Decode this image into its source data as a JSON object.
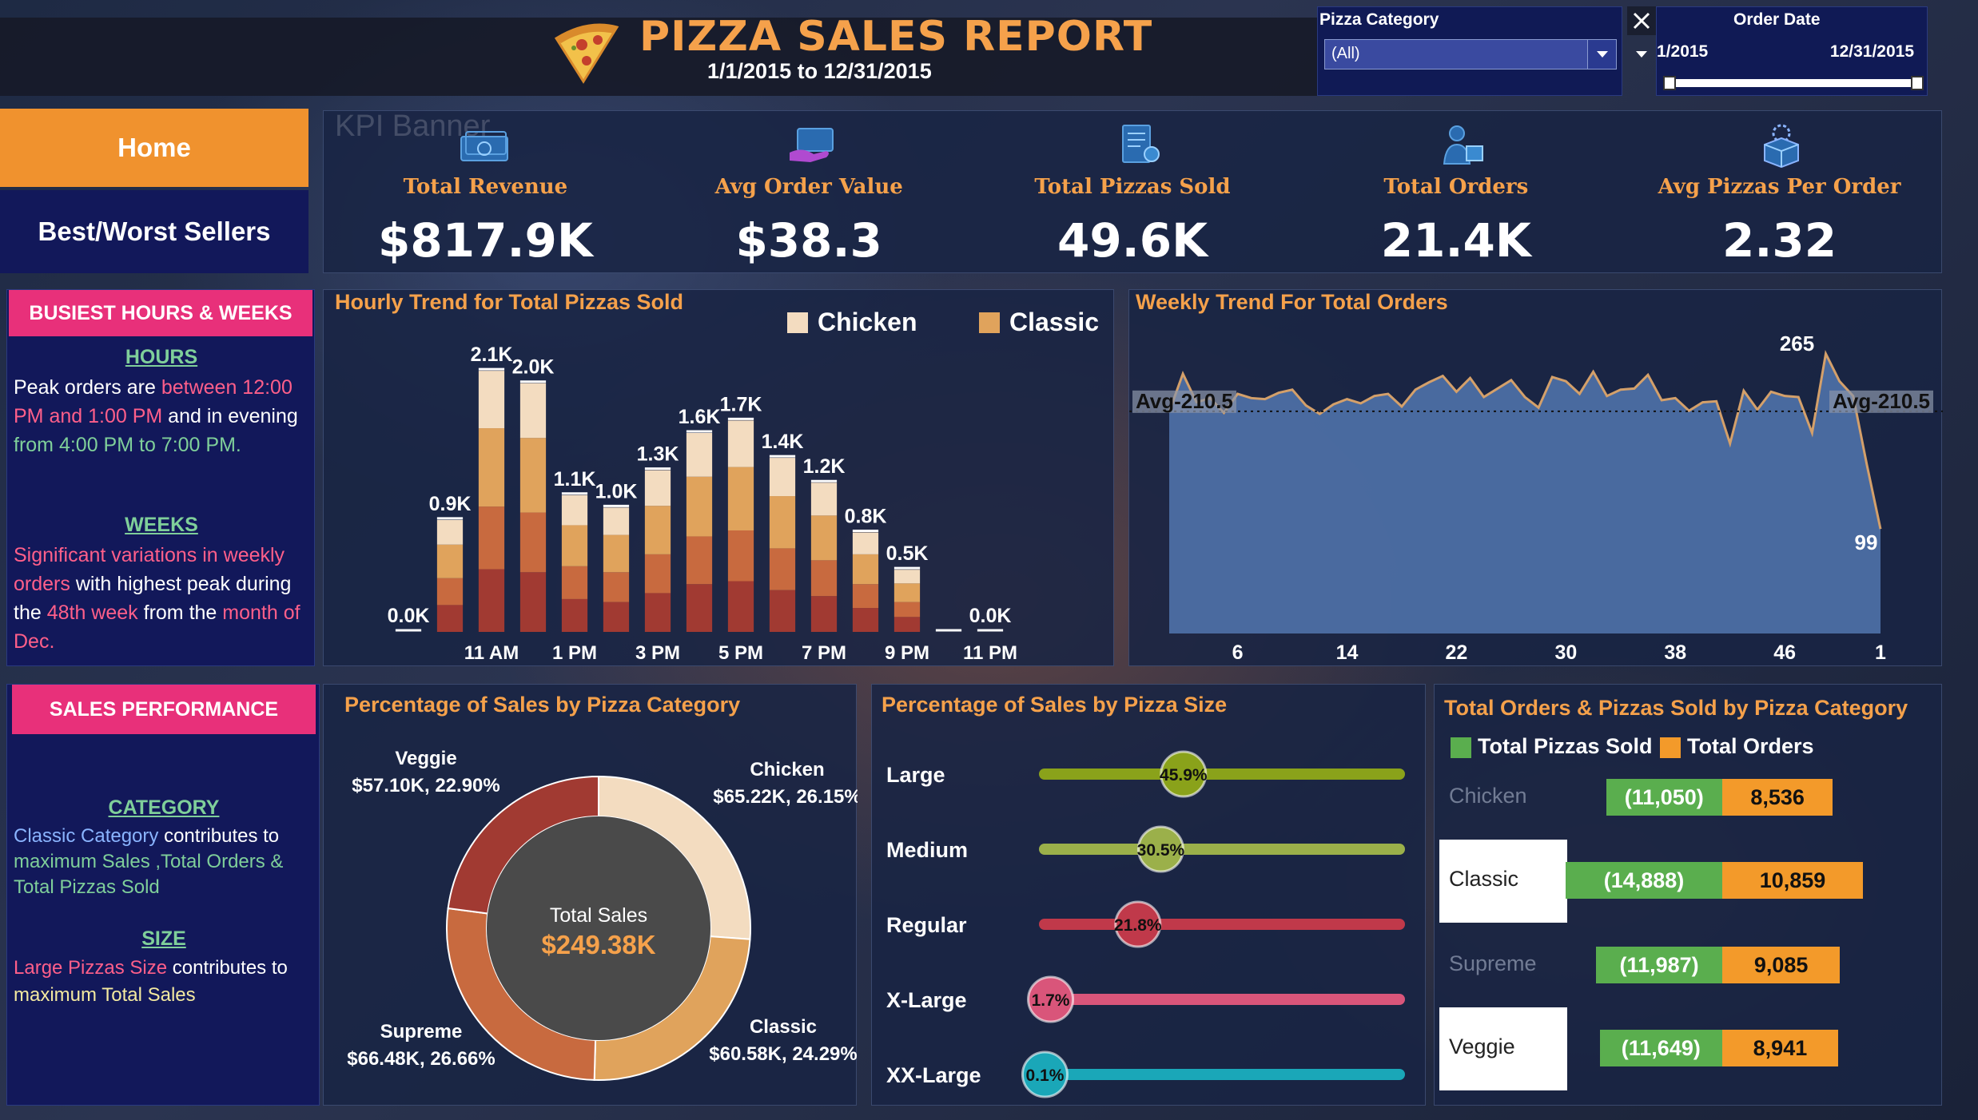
{
  "header": {
    "title": "PIZZA SALES REPORT",
    "date_range": "1/1/2015  to 12/31/2015",
    "logo_icon": "pizza-slice-icon"
  },
  "filters": {
    "category": {
      "label": "Pizza Category",
      "value": "(All)"
    },
    "order_date": {
      "label": "Order Date",
      "start": "1/2015",
      "end": "12/31/2015"
    }
  },
  "nav": {
    "home": "Home",
    "best_worst": "Best/Worst Sellers"
  },
  "kpi": {
    "banner_label": "KPI Banner",
    "items": [
      {
        "label": "Total Revenue",
        "value": "$817.9K",
        "icon": "cash-icon"
      },
      {
        "label": "Avg Order Value",
        "value": "$38.3",
        "icon": "card-payment-icon"
      },
      {
        "label": "Total Pizzas Sold",
        "value": "49.6K",
        "icon": "receipt-icon"
      },
      {
        "label": "Total Orders",
        "value": "21.4K",
        "icon": "delivery-person-icon"
      },
      {
        "label": "Avg Pizzas Per Order",
        "value": "2.32",
        "icon": "box-icon"
      }
    ]
  },
  "busiest": {
    "tab": "BUSIEST HOURS & WEEKS",
    "hours_heading": "HOURS",
    "hours_text": {
      "p1": "Peak orders are ",
      "p2": "between 12:00 PM and 1:00 PM",
      "p3": " and in evening ",
      "p4": "from 4:00 PM to 7:00 PM."
    },
    "weeks_heading": "WEEKS",
    "weeks_text": {
      "p1": "Significant variations in weekly orders",
      "p2": " with highest peak during the ",
      "p3": "48th week",
      "p4": " from the ",
      "p5": "month of Dec."
    }
  },
  "sales_perf": {
    "tab": "SALES PERFORMANCE",
    "category_heading": "CATEGORY",
    "category_text": {
      "p1": "Classic Category",
      "p2": " contributes to ",
      "p3": "maximum Sales ,Total Orders & Total Pizzas Sold"
    },
    "size_heading": "SIZE",
    "size_text": {
      "p1": "Large Pizzas Size",
      "p2": " contributes to ",
      "p3": "maximum Total Sales"
    }
  },
  "panels": {
    "hourly_title": "Hourly Trend for Total Pizzas Sold",
    "weekly_title": "Weekly Trend For Total Orders",
    "category_title": "Percentage of Sales by Pizza Category",
    "size_title": "Percentage of Sales by Pizza Size",
    "orders_title": "Total Orders & Pizzas Sold by Pizza Category"
  },
  "colors": {
    "accent_orange": "#f5a14b",
    "pink": "#e8307a",
    "navy": "#12185a",
    "chicken": "#f3dcc0",
    "classic": "#e0a35c",
    "supreme": "#c86a3f",
    "veggie": "#a13a32",
    "green_bar": "#5aae4e",
    "orange_bar": "#f39a2a"
  },
  "chart_data": [
    {
      "type": "bar",
      "title": "Hourly Trend for Total Pizzas Sold",
      "stacked": true,
      "legend": [
        "Chicken",
        "Classic"
      ],
      "legend_position": "top-right",
      "categories": [
        9,
        10,
        11,
        12,
        13,
        14,
        15,
        16,
        17,
        18,
        19,
        20,
        21,
        22,
        23
      ],
      "tick_labels": [
        "11 AM",
        "1 PM",
        "3 PM",
        "5 PM",
        "7 PM",
        "9 PM",
        "11 PM"
      ],
      "tick_positions": [
        11,
        13,
        15,
        17,
        19,
        21,
        23
      ],
      "totals": [
        0.0,
        0.9,
        2.1,
        2.0,
        1.1,
        1.0,
        1.3,
        1.6,
        1.7,
        1.4,
        1.2,
        0.8,
        0.5,
        0.0,
        0.0
      ],
      "value_labels": [
        "0.0K",
        "0.9K",
        "2.1K",
        "2.0K",
        "1.1K",
        "1.0K",
        "1.3K",
        "1.6K",
        "1.7K",
        "1.4K",
        "1.2K",
        "0.8K",
        "0.5K",
        "",
        "0.0K"
      ],
      "series_share": [
        {
          "name": "Chicken",
          "share": 0.22
        },
        {
          "name": "Classic",
          "share": 0.3
        },
        {
          "name": "",
          "share": 0.24
        },
        {
          "name": "",
          "share": 0.24
        }
      ],
      "ylim": [
        0,
        2.3
      ]
    },
    {
      "type": "area",
      "title": "Weekly Trend For Total Orders",
      "x_ticks": [
        "6",
        "14",
        "22",
        "30",
        "38",
        "46",
        "1"
      ],
      "values": [
        210,
        246,
        219,
        223,
        209,
        227,
        223,
        222,
        228,
        231,
        216,
        208,
        217,
        222,
        218,
        225,
        227,
        215,
        231,
        238,
        244,
        229,
        242,
        224,
        232,
        240,
        224,
        214,
        243,
        239,
        227,
        248,
        225,
        231,
        232,
        245,
        221,
        223,
        211,
        219,
        220,
        180,
        230,
        212,
        229,
        225,
        224,
        190,
        265,
        239,
        225,
        160,
        99
      ],
      "ylim": [
        0,
        280
      ],
      "avg_line": 210.5,
      "avg_label": "Avg-210.5",
      "annotations": [
        "265",
        "99"
      ]
    },
    {
      "type": "pie",
      "title": "Percentage of Sales by Pizza Category",
      "center_label": "Total Sales",
      "center_value": "$249.38K",
      "slices": [
        {
          "name": "Chicken",
          "value": 65.22,
          "pct": 26.15,
          "label": "$65.22K, 26.15%"
        },
        {
          "name": "Classic",
          "value": 60.58,
          "pct": 24.29,
          "label": "$60.58K, 24.29%"
        },
        {
          "name": "Supreme",
          "value": 66.48,
          "pct": 26.66,
          "label": "$66.48K, 26.66%"
        },
        {
          "name": "Veggie",
          "value": 57.1,
          "pct": 22.9,
          "label": "$57.10K, 22.90%"
        }
      ]
    },
    {
      "type": "bar",
      "title": "Percentage of Sales by Pizza Size",
      "categories": [
        "Large",
        "Medium",
        "Regular",
        "X-Large",
        "XX-Large"
      ],
      "values": [
        45.9,
        30.5,
        21.8,
        1.7,
        0.1
      ],
      "value_labels": [
        "45.9%",
        "30.5%",
        "21.8%",
        "1.7%",
        "0.1%"
      ],
      "colors": [
        "#8aa21a",
        "#9bb04a",
        "#c0394a",
        "#d9557a",
        "#1aa7b8"
      ]
    },
    {
      "type": "bar",
      "title": "Total Orders & Pizzas Sold by Pizza Category",
      "legend_position": "top-left",
      "categories": [
        "Chicken",
        "Classic",
        "Supreme",
        "Veggie"
      ],
      "series": [
        {
          "name": "Total Pizzas Sold",
          "values": [
            11050,
            14888,
            11987,
            11649
          ],
          "labels": [
            "(11,050)",
            "(14,888)",
            "(11,987)",
            "(11,649)"
          ]
        },
        {
          "name": "Total Orders",
          "values": [
            8536,
            10859,
            9085,
            8941
          ],
          "labels": [
            "8,536",
            "10,859",
            "9,085",
            "8,941"
          ]
        }
      ]
    }
  ]
}
